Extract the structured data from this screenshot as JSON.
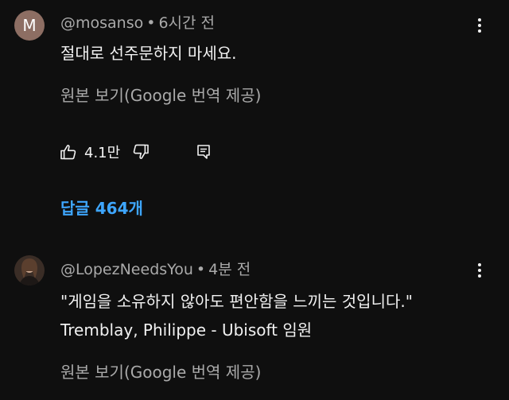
{
  "comments": [
    {
      "avatar_letter": "M",
      "author": "@mosanso",
      "time": "6시간 전",
      "lines": [
        "절대로 선주문하지 마세요."
      ],
      "translate_label": "원본 보기(Google 번역 제공)",
      "like_count": "4.1만",
      "replies_label": "답글 464개"
    },
    {
      "author": "@LopezNeedsYou",
      "time": "4분 전",
      "lines": [
        "\"게임을 소유하지 않아도 편안함을 느끼는 것입니다.\"",
        "Tremblay, Philippe - Ubisoft 임원"
      ],
      "translate_label": "원본 보기(Google 번역 제공)"
    }
  ],
  "icons": {
    "like": "thumbs-up-icon",
    "dislike": "thumbs-down-icon",
    "reply": "reply-comment-icon",
    "menu": "more-vert-icon"
  },
  "colors": {
    "background": "#0f0f0f",
    "text": "#f1f1f1",
    "secondary": "#aaaaaa",
    "link": "#3ea6ff"
  }
}
